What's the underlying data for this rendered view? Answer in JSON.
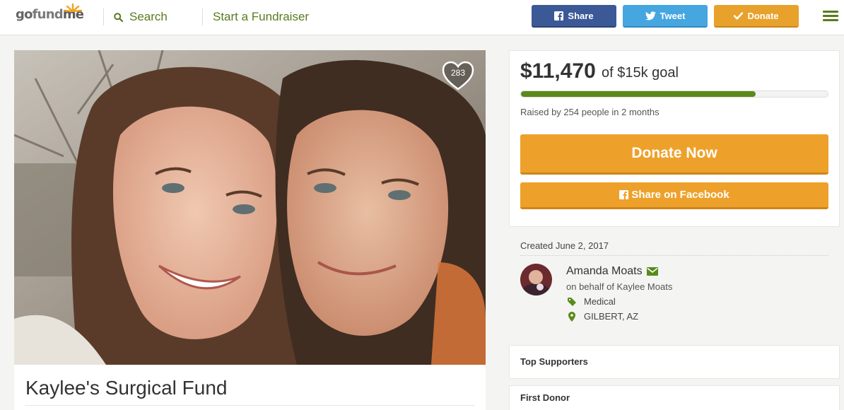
{
  "header": {
    "logo": {
      "go": "go",
      "fund": "fund",
      "me": "me"
    },
    "search_label": "Search",
    "start_label": "Start a Fundraiser",
    "share_label": "Share",
    "tweet_label": "Tweet",
    "donate_label": "Donate"
  },
  "campaign": {
    "heart_count": "283",
    "title": "Kaylee's Surgical Fund",
    "raised": "$11,470",
    "goal": "of $15k goal",
    "progress_fraction": 0.7647,
    "raised_by": "Raised by 254 people in 2 months",
    "donate_now": "Donate Now",
    "share_facebook": "Share on Facebook"
  },
  "organizer": {
    "created": "Created June 2, 2017",
    "name": "Amanda Moats",
    "behalf": "on behalf of Kaylee Moats",
    "category": "Medical",
    "location": "GILBERT, AZ"
  },
  "sections": {
    "top_supporters": "Top Supporters",
    "first_donor": "First Donor"
  },
  "colors": {
    "brand_green": "#587b1e",
    "progress_green": "#5a8a1b",
    "orange": "#eea12a",
    "facebook_blue": "#3b5897",
    "twitter_blue": "#45a6e0"
  }
}
